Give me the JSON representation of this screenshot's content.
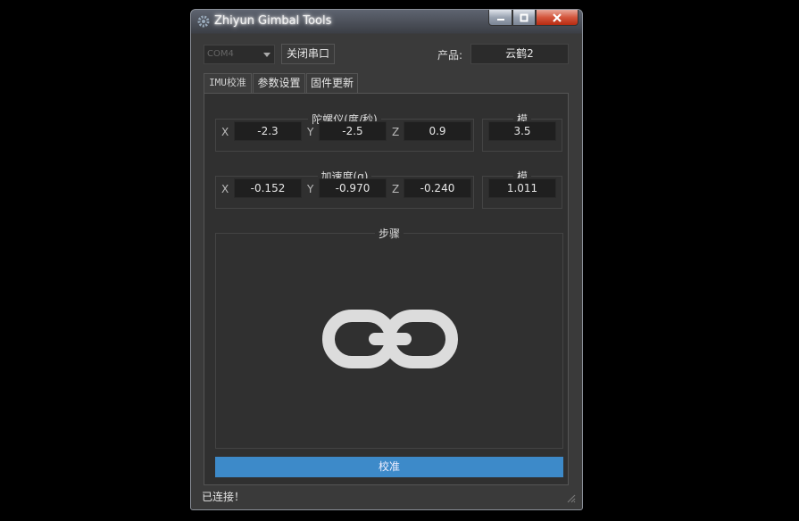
{
  "window": {
    "title": "Zhiyun Gimbal Tools",
    "caption_buttons": {
      "minimize": "–",
      "maximize": "□",
      "close": "✕"
    }
  },
  "toolbar": {
    "port_combo_value": "COM4",
    "close_port_label": "关闭串口",
    "product_label": "产品:",
    "product_value": "云鹤2"
  },
  "tabs": [
    {
      "label": "IMU校准",
      "active": true
    },
    {
      "label": "参数设置",
      "active": false
    },
    {
      "label": "固件更新",
      "active": false
    }
  ],
  "gyro": {
    "title": "陀螺仪(度/秒)",
    "x_label": "X",
    "x": "-2.3",
    "y_label": "Y",
    "y": "-2.5",
    "z_label": "Z",
    "z": "0.9",
    "norm_title": "模",
    "norm": "3.5"
  },
  "accel": {
    "title": "加速度(g)",
    "x_label": "X",
    "x": "-0.152",
    "y_label": "Y",
    "y": "-0.970",
    "z_label": "Z",
    "z": "-0.240",
    "norm_title": "模",
    "norm": "1.011"
  },
  "steps": {
    "title": "步骤",
    "icon": "link-icon"
  },
  "calibrate_label": "校准",
  "status_text": "已连接！",
  "colors": {
    "accent": "#3d8ac9",
    "panel": "#303030",
    "field": "#1f1f1f",
    "link_icon": "#dcdcdc"
  }
}
